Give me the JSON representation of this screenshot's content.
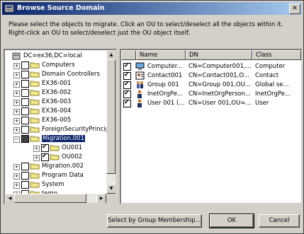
{
  "window": {
    "title": "Browse Source Domain",
    "close_glyph": "✕"
  },
  "instructions": "Please select the objects to migrate. Click an OU to select/deselect all the objects within it. Right-click an OU to select/deselect just the OU object itself.",
  "tree": {
    "root": "DC=ex36,DC=local",
    "items": [
      {
        "label": "Computers",
        "checked": false,
        "expander": "+"
      },
      {
        "label": "Domain Controllers",
        "checked": false,
        "expander": "+"
      },
      {
        "label": "EX36-001",
        "checked": false,
        "expander": "+"
      },
      {
        "label": "EX36-002",
        "checked": false,
        "expander": "+"
      },
      {
        "label": "EX36-003",
        "checked": false,
        "expander": "+"
      },
      {
        "label": "EX36-004",
        "checked": false,
        "expander": "+"
      },
      {
        "label": "EX36-005",
        "checked": false,
        "expander": "+"
      },
      {
        "label": "ForeignSecurityPrincipa",
        "checked": false,
        "expander": "+"
      },
      {
        "label": "Migration.001",
        "checked": "partial",
        "expander": "−"
      },
      {
        "label": "OU001",
        "checked": true,
        "expander": "+"
      },
      {
        "label": "OU002",
        "checked": true,
        "expander": "+"
      },
      {
        "label": "Migration.002",
        "checked": false,
        "expander": "+"
      },
      {
        "label": "Program Data",
        "checked": false,
        "expander": "+"
      },
      {
        "label": "System",
        "checked": false,
        "expander": "+"
      },
      {
        "label": "temp",
        "checked": false,
        "expander": "+"
      }
    ]
  },
  "list": {
    "columns": [
      "Name",
      "DN",
      "Class"
    ],
    "rows": [
      {
        "name": "Computer...",
        "dn": "CN=Computer001,...",
        "class": "Computer",
        "checked": true,
        "icon": "computer-icon"
      },
      {
        "name": "Contact001",
        "dn": "CN=Contact001,O...",
        "class": "Contact",
        "checked": true,
        "icon": "contact-icon"
      },
      {
        "name": "Group 001",
        "dn": "CN=Group 001,OU...",
        "class": "Global se...",
        "checked": true,
        "icon": "group-icon"
      },
      {
        "name": "InetOrgPe...",
        "dn": "CN=InetOrgPerson...",
        "class": "InetOrgPe...",
        "checked": true,
        "icon": "user-icon"
      },
      {
        "name": "User 001 (...",
        "dn": "CN=User 001,OU=...",
        "class": "User",
        "checked": true,
        "icon": "user-icon"
      }
    ]
  },
  "buttons": {
    "select_by_group": "Select by Group Membership...",
    "ok": "OK",
    "cancel": "Cancel"
  },
  "scroll_glyphs": {
    "up": "▲",
    "down": "▼",
    "left": "◀",
    "right": "▶"
  },
  "colors": {
    "title_start": "#0a246a",
    "title_end": "#a6caf0",
    "selection": "#0a246a"
  }
}
